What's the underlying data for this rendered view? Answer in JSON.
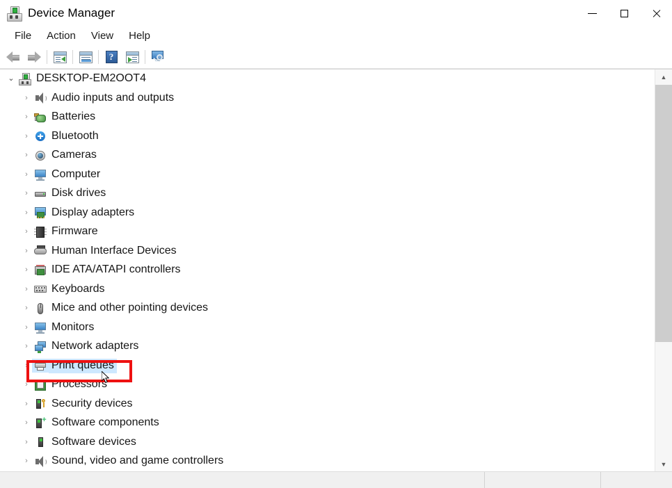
{
  "window": {
    "title": "Device Manager",
    "icon": "device-manager-icon",
    "controls": {
      "minimize": "Minimize",
      "maximize": "Maximize",
      "close": "Close"
    }
  },
  "menubar": {
    "items": [
      {
        "label": "File"
      },
      {
        "label": "Action"
      },
      {
        "label": "View"
      },
      {
        "label": "Help"
      }
    ]
  },
  "toolbar": {
    "buttons": [
      {
        "name": "back-button",
        "icon": "back-arrow-icon",
        "enabled": false
      },
      {
        "name": "forward-button",
        "icon": "forward-arrow-icon",
        "enabled": false
      },
      {
        "name": "show-hide-console-tree-button",
        "icon": "console-tree-icon",
        "enabled": true
      },
      {
        "name": "properties-button",
        "icon": "properties-icon",
        "enabled": true
      },
      {
        "name": "help-button",
        "icon": "help-icon",
        "enabled": true
      },
      {
        "name": "update-driver-button",
        "icon": "update-driver-icon",
        "enabled": true
      },
      {
        "name": "scan-for-hardware-changes-button",
        "icon": "scan-hardware-icon",
        "enabled": true
      }
    ],
    "help_glyph": "?"
  },
  "tree": {
    "root": {
      "label": "DESKTOP-EM2OOT4",
      "icon": "computer-icon",
      "expanded": true,
      "chevron": "⌄"
    },
    "child_chevron": "›",
    "items": [
      {
        "label": "Audio inputs and outputs",
        "icon": "speaker-icon",
        "name": "tree-item-audio-inputs-and-outputs",
        "selected": false
      },
      {
        "label": "Batteries",
        "icon": "battery-icon",
        "name": "tree-item-batteries",
        "selected": false
      },
      {
        "label": "Bluetooth",
        "icon": "bluetooth-icon",
        "name": "tree-item-bluetooth",
        "selected": false
      },
      {
        "label": "Cameras",
        "icon": "camera-icon",
        "name": "tree-item-cameras",
        "selected": false
      },
      {
        "label": "Computer",
        "icon": "monitor-icon",
        "name": "tree-item-computer",
        "selected": false
      },
      {
        "label": "Disk drives",
        "icon": "disk-drive-icon",
        "name": "tree-item-disk-drives",
        "selected": false
      },
      {
        "label": "Display adapters",
        "icon": "display-adapter-icon",
        "name": "tree-item-display-adapters",
        "selected": false
      },
      {
        "label": "Firmware",
        "icon": "firmware-chip-icon",
        "name": "tree-item-firmware",
        "selected": false
      },
      {
        "label": "Human Interface Devices",
        "icon": "hid-icon",
        "name": "tree-item-human-interface-devices",
        "selected": false
      },
      {
        "label": "IDE ATA/ATAPI controllers",
        "icon": "ide-controller-icon",
        "name": "tree-item-ide-ata-atapi-controllers",
        "selected": false
      },
      {
        "label": "Keyboards",
        "icon": "keyboard-icon",
        "name": "tree-item-keyboards",
        "selected": false
      },
      {
        "label": "Mice and other pointing devices",
        "icon": "mouse-icon",
        "name": "tree-item-mice-and-other-pointing-devices",
        "selected": false
      },
      {
        "label": "Monitors",
        "icon": "monitor-icon",
        "name": "tree-item-monitors",
        "selected": false
      },
      {
        "label": "Network adapters",
        "icon": "network-adapter-icon",
        "name": "tree-item-network-adapters",
        "selected": false
      },
      {
        "label": "Print queues",
        "icon": "printer-icon",
        "name": "tree-item-print-queues",
        "selected": true
      },
      {
        "label": "Processors",
        "icon": "processor-icon",
        "name": "tree-item-processors",
        "selected": false
      },
      {
        "label": "Security devices",
        "icon": "security-device-icon",
        "name": "tree-item-security-devices",
        "selected": false
      },
      {
        "label": "Software components",
        "icon": "software-component-icon",
        "name": "tree-item-software-components",
        "selected": false
      },
      {
        "label": "Software devices",
        "icon": "software-device-icon",
        "name": "tree-item-software-devices",
        "selected": false
      },
      {
        "label": "Sound, video and game controllers",
        "icon": "speaker-icon",
        "name": "tree-item-sound-video-and-game-controllers",
        "selected": false
      }
    ]
  },
  "scrollbar": {
    "up_glyph": "▲",
    "down_glyph": "▼"
  },
  "statusbar": {
    "panes": [
      "",
      "",
      ""
    ]
  },
  "annotation": {
    "target": "Print queues",
    "color": "#ee1111"
  },
  "colors": {
    "selection": "#cde8ff",
    "annotation": "#ee1111",
    "scrollbar_thumb": "#cdcdcd",
    "statusbar": "#f0f0f0"
  }
}
